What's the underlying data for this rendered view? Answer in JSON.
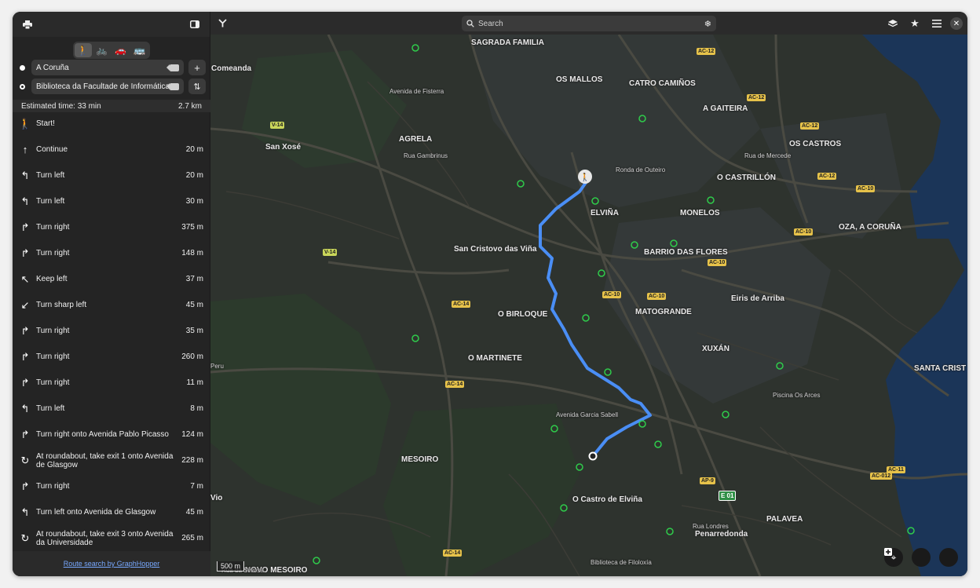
{
  "header": {
    "left_icon": "printer-icon",
    "sidebar_toggle_icon": "sidebar-toggle-icon",
    "app_icon": "route-app-icon"
  },
  "modes": [
    {
      "icon": "walk-icon",
      "glyph": "🚶",
      "active": true
    },
    {
      "icon": "bike-icon",
      "glyph": "🚲",
      "active": false
    },
    {
      "icon": "car-icon",
      "glyph": "🚗",
      "active": false
    },
    {
      "icon": "bus-icon",
      "glyph": "🚌",
      "active": false
    }
  ],
  "waypoints": {
    "origin": "A Coruña",
    "destination": "Biblioteca da Facultade de Informática"
  },
  "summary": {
    "time": "Estimated time: 33 min",
    "distance": "2.7 km"
  },
  "steps": [
    {
      "icon": "walk-icon",
      "glyph": "🚶",
      "text": "Start!",
      "dist": ""
    },
    {
      "icon": "arrow-up-icon",
      "glyph": "↑",
      "text": "Continue",
      "dist": "20 m"
    },
    {
      "icon": "turn-left-icon",
      "glyph": "↰",
      "text": "Turn left",
      "dist": "20 m"
    },
    {
      "icon": "turn-left-icon",
      "glyph": "↰",
      "text": "Turn left",
      "dist": "30 m"
    },
    {
      "icon": "turn-right-icon",
      "glyph": "↱",
      "text": "Turn right",
      "dist": "375 m"
    },
    {
      "icon": "turn-right-icon",
      "glyph": "↱",
      "text": "Turn right",
      "dist": "148 m"
    },
    {
      "icon": "keep-left-icon",
      "glyph": "↖",
      "text": "Keep left",
      "dist": "37 m"
    },
    {
      "icon": "sharp-left-icon",
      "glyph": "↙",
      "text": "Turn sharp left",
      "dist": "45 m"
    },
    {
      "icon": "turn-right-icon",
      "glyph": "↱",
      "text": "Turn right",
      "dist": "35 m"
    },
    {
      "icon": "turn-right-icon",
      "glyph": "↱",
      "text": "Turn right",
      "dist": "260 m"
    },
    {
      "icon": "turn-right-icon",
      "glyph": "↱",
      "text": "Turn right",
      "dist": "11 m"
    },
    {
      "icon": "turn-left-icon",
      "glyph": "↰",
      "text": "Turn left",
      "dist": "8 m"
    },
    {
      "icon": "turn-right-icon",
      "glyph": "↱",
      "text": "Turn right onto Avenida Pablo Picasso",
      "dist": "124 m"
    },
    {
      "icon": "roundabout-icon",
      "glyph": "↻",
      "text": "At roundabout, take exit 1 onto Avenida de Glasgow",
      "dist": "228 m"
    },
    {
      "icon": "turn-right-icon",
      "glyph": "↱",
      "text": "Turn right",
      "dist": "7 m"
    },
    {
      "icon": "turn-left-icon",
      "glyph": "↰",
      "text": "Turn left onto Avenida de Glasgow",
      "dist": "45 m"
    },
    {
      "icon": "roundabout-icon",
      "glyph": "↻",
      "text": "At roundabout, take exit 3 onto Avenida da Universidade",
      "dist": "265 m"
    }
  ],
  "footer": {
    "link": "Route search by GraphHopper"
  },
  "search": {
    "placeholder": "Search"
  },
  "map": {
    "places": [
      {
        "name": "SAGRADA FAMILIA",
        "cls": ""
      },
      {
        "name": "OS MALLOS",
        "cls": ""
      },
      {
        "name": "CATRO CAMIÑOS",
        "cls": ""
      },
      {
        "name": "A GAITEIRA",
        "cls": ""
      },
      {
        "name": "OS CASTROS",
        "cls": ""
      },
      {
        "name": "O CASTRILLÓN",
        "cls": ""
      },
      {
        "name": "AGRELA",
        "cls": ""
      },
      {
        "name": "San Xosé",
        "cls": ""
      },
      {
        "name": "Comeanda",
        "cls": ""
      },
      {
        "name": "ELVIÑA",
        "cls": ""
      },
      {
        "name": "MONELOS",
        "cls": ""
      },
      {
        "name": "OZA, A CORUÑA",
        "cls": ""
      },
      {
        "name": "San Cristovo das Viña",
        "cls": ""
      },
      {
        "name": "BARRIO DAS FLORES",
        "cls": ""
      },
      {
        "name": "Eiris de Arriba",
        "cls": ""
      },
      {
        "name": "O BIRLOQUE",
        "cls": ""
      },
      {
        "name": "MATOGRANDE",
        "cls": ""
      },
      {
        "name": "XUXÁN",
        "cls": ""
      },
      {
        "name": "O MARTINETE",
        "cls": ""
      },
      {
        "name": "SANTA CRIST",
        "cls": ""
      },
      {
        "name": "MESOIRO",
        "cls": ""
      },
      {
        "name": "O Castro de Elviña",
        "cls": ""
      },
      {
        "name": "PALAVEA",
        "cls": ""
      },
      {
        "name": "Penarredonda",
        "cls": ""
      },
      {
        "name": "NOVO MESOIRO",
        "cls": ""
      },
      {
        "name": "Avenida de Fisterra",
        "cls": "small"
      },
      {
        "name": "Rua Gambrinus",
        "cls": "small"
      },
      {
        "name": "Ronda de Outeiro",
        "cls": "small"
      },
      {
        "name": "Rua de Mercede",
        "cls": "small"
      },
      {
        "name": "Avenida Garcia Sabell",
        "cls": "small"
      },
      {
        "name": "Piscina Os Arces",
        "cls": "small"
      },
      {
        "name": "Rua Londres",
        "cls": "small"
      },
      {
        "name": "Biblioteca de Filoloxía",
        "cls": "small"
      },
      {
        "name": "Rua da Silvosa",
        "cls": "small"
      },
      {
        "name": "Vio",
        "cls": ""
      },
      {
        "name": "Peru",
        "cls": "small"
      }
    ],
    "shields": [
      {
        "label": "V-14",
        "cls": "lime"
      },
      {
        "label": "V-14",
        "cls": "lime"
      },
      {
        "label": "AC-12",
        "cls": ""
      },
      {
        "label": "AC-12",
        "cls": ""
      },
      {
        "label": "AC-12",
        "cls": ""
      },
      {
        "label": "AC-12",
        "cls": ""
      },
      {
        "label": "AC-10",
        "cls": ""
      },
      {
        "label": "AC-10",
        "cls": ""
      },
      {
        "label": "AC-10",
        "cls": ""
      },
      {
        "label": "AC-10",
        "cls": ""
      },
      {
        "label": "AC-10",
        "cls": ""
      },
      {
        "label": "AC-14",
        "cls": ""
      },
      {
        "label": "AC-14",
        "cls": ""
      },
      {
        "label": "AC-14",
        "cls": ""
      },
      {
        "label": "AP-9",
        "cls": ""
      },
      {
        "label": "E 01",
        "cls": "green"
      },
      {
        "label": "AC-11",
        "cls": ""
      },
      {
        "label": "AC-012",
        "cls": ""
      }
    ],
    "scale": "500 m",
    "controls": [
      "locate-icon",
      "zoom-out-icon",
      "zoom-in-icon"
    ]
  }
}
